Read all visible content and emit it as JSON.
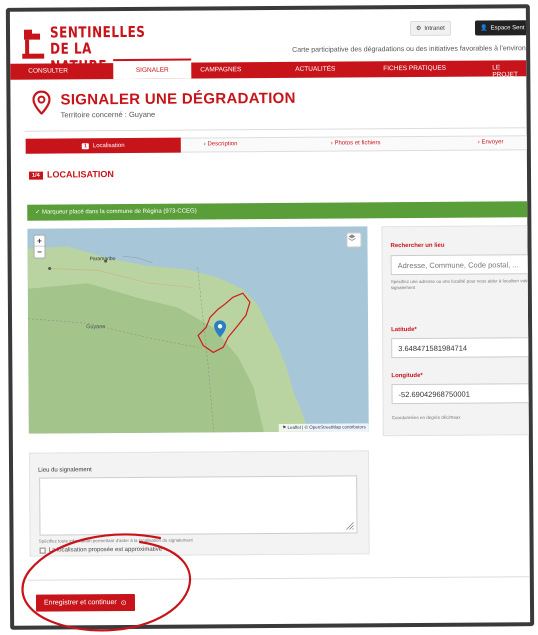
{
  "header": {
    "logo_line1": "SENTINELLES",
    "logo_line2": "DE LA NATURE",
    "intranet_label": "Intranet",
    "espace_label": "Espace Sent",
    "tagline": "Carte participative des dégradations ou des initiatives favorables à l'environ"
  },
  "nav": {
    "items": [
      {
        "label": "CONSULTER"
      },
      {
        "label": "SIGNALER"
      },
      {
        "label": "CAMPAGNES"
      },
      {
        "label": "ACTUALITÉS"
      },
      {
        "label": "FICHES PRATIQUES"
      },
      {
        "label": "LE PROJET"
      }
    ],
    "active_index": 1
  },
  "page": {
    "title": "SIGNALER UNE DÉGRADATION",
    "subtitle": "Territoire concerné : Guyane"
  },
  "steps": {
    "active_num": "1",
    "items": [
      {
        "label": "Localisation"
      },
      {
        "label": "Description"
      },
      {
        "label": "Photos et fichiers"
      },
      {
        "label": "Envoyer"
      }
    ]
  },
  "section": {
    "badge": "1/4",
    "title": "LOCALISATION"
  },
  "alert": {
    "text": "✓ Marqueur placé dans la commune de Régina (973-CCEG)"
  },
  "map": {
    "zoom_in": "+",
    "zoom_out": "−",
    "attribution": "⚑ Leaflet | © OpenStreetMap contributors",
    "place_label": "Guyane",
    "town_label": "Paramaribo",
    "colors": {
      "sea": "#a7c7d8",
      "land": "#b9d4a0",
      "forest": "#a3c48a",
      "boundary": "#d11a1a",
      "marker": "#2a7fc1"
    }
  },
  "search": {
    "label": "Rechercher un lieu",
    "placeholder": "Adresse, Commune, Code postal, ...",
    "help": "Spécifiez une adresse ou une localité pour vous aider à localiser votre signalement"
  },
  "coords": {
    "lat_label": "Latitude*",
    "lat_value": "3.648471581984714",
    "lng_label": "Longitude*",
    "lng_value": "-52.69042968750001",
    "help": "Coordonnées en degrés décimaux"
  },
  "lieu": {
    "label": "Lieu du signalement",
    "help": "Spécifiez toute information permettant d'aider à la localisation du signalement",
    "approx_label": "La localisation proposée est approximative"
  },
  "actions": {
    "save_label": "Enregistrer et continuer",
    "save_icon": "⊙"
  }
}
